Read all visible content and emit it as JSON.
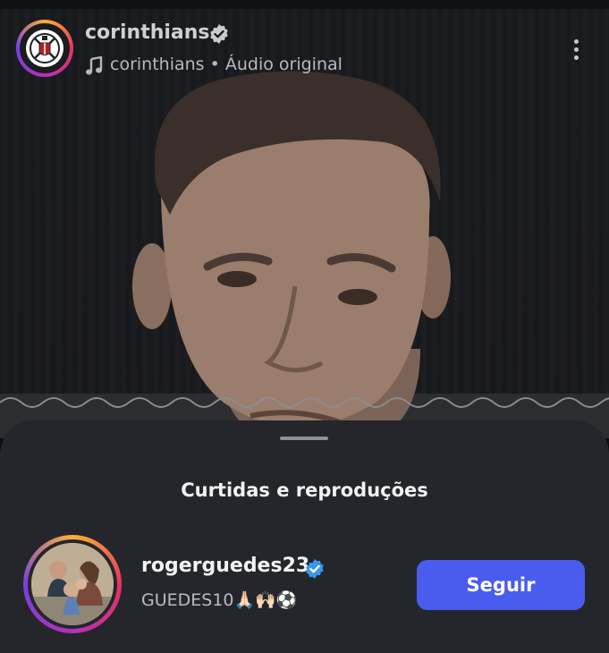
{
  "header": {
    "account_name": "corinthians",
    "audio_author": "corinthians",
    "audio_separator": " • ",
    "audio_type": "Áudio original"
  },
  "sheet": {
    "title": "Curtidas e reproduções",
    "user": {
      "username": "rogerguedes23",
      "bio": "GUEDES10🙏🏻🙌🏻⚽",
      "follow_label": "Seguir"
    }
  },
  "colors": {
    "sheet_bg": "#24262b",
    "follow_button": "#4a5cf0",
    "verified_badge": "#3897f0",
    "story_ring": [
      "#f9b233",
      "#e8345f",
      "#b52fb8",
      "#7a3fe0"
    ]
  },
  "icons": {
    "verified": "verified-badge-icon",
    "music": "music-note-icon",
    "more": "more-vertical-icon"
  }
}
